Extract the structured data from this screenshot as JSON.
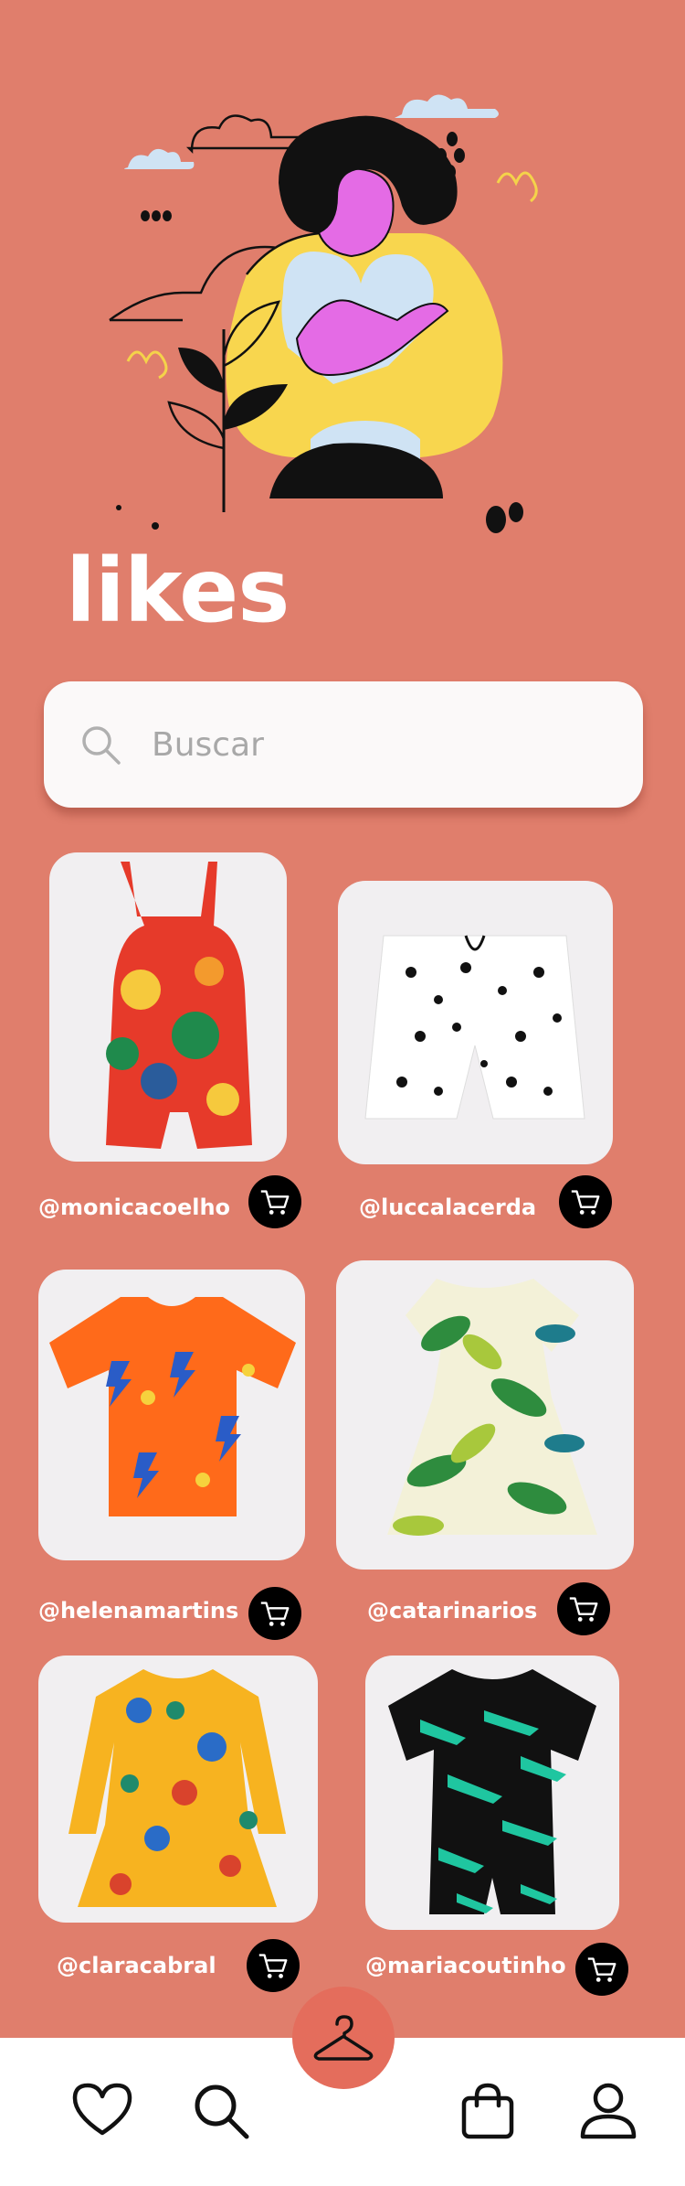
{
  "page": {
    "title": "likes"
  },
  "search": {
    "placeholder": "Buscar",
    "value": ""
  },
  "products": [
    {
      "handle": "@monicacoelho",
      "item": "overalls"
    },
    {
      "handle": "@luccalacerda",
      "item": "shorts"
    },
    {
      "handle": "@helenamartins",
      "item": "t-shirt"
    },
    {
      "handle": "@catarinarios",
      "item": "dress"
    },
    {
      "handle": "@claracabral",
      "item": "long-sleeve dress"
    },
    {
      "handle": "@mariacoutinho",
      "item": "romper"
    }
  ],
  "nav": {
    "items": [
      "heart-icon",
      "search-icon",
      "hanger-icon",
      "bag-icon",
      "user-icon"
    ]
  },
  "colors": {
    "background": "#E07E6C",
    "fab": "#E46D5C",
    "card": "#F1EFF1",
    "cart": "#000000"
  }
}
